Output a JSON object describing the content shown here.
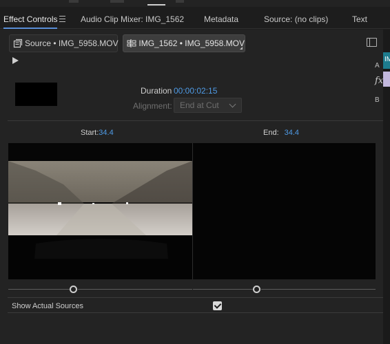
{
  "tabs": [
    {
      "label": "Effect Controls",
      "active": true
    },
    {
      "label": "Audio Clip Mixer: IMG_1562",
      "active": false
    },
    {
      "label": "Metadata",
      "active": false
    },
    {
      "label": "Source: (no clips)",
      "active": false
    },
    {
      "label": "Text",
      "active": false
    }
  ],
  "clip_tabs": {
    "source": "Source • IMG_5958.MOV",
    "sequence": "IMG_1562 • IMG_5958.MOV"
  },
  "transition": {
    "duration_label": "Duration",
    "duration_value": "00:00:02:15",
    "alignment_label": "Alignment:",
    "alignment_value": "End at Cut"
  },
  "preview": {
    "start_label": "Start:",
    "start_value": "34.4",
    "end_label": "End:",
    "end_value": "34.4"
  },
  "options": {
    "show_actual_sources_label": "Show Actual Sources",
    "show_actual_sources_checked": true
  },
  "side": {
    "track_a": "A",
    "fx": "fx",
    "track_b": "B",
    "clip_text": "IM"
  },
  "colors": {
    "accent_blue": "#4f9be6",
    "active_tab_underline": "#5a8fd8",
    "clip_teal": "#1d7c8e",
    "clip_lavender": "#c2b8dd"
  }
}
